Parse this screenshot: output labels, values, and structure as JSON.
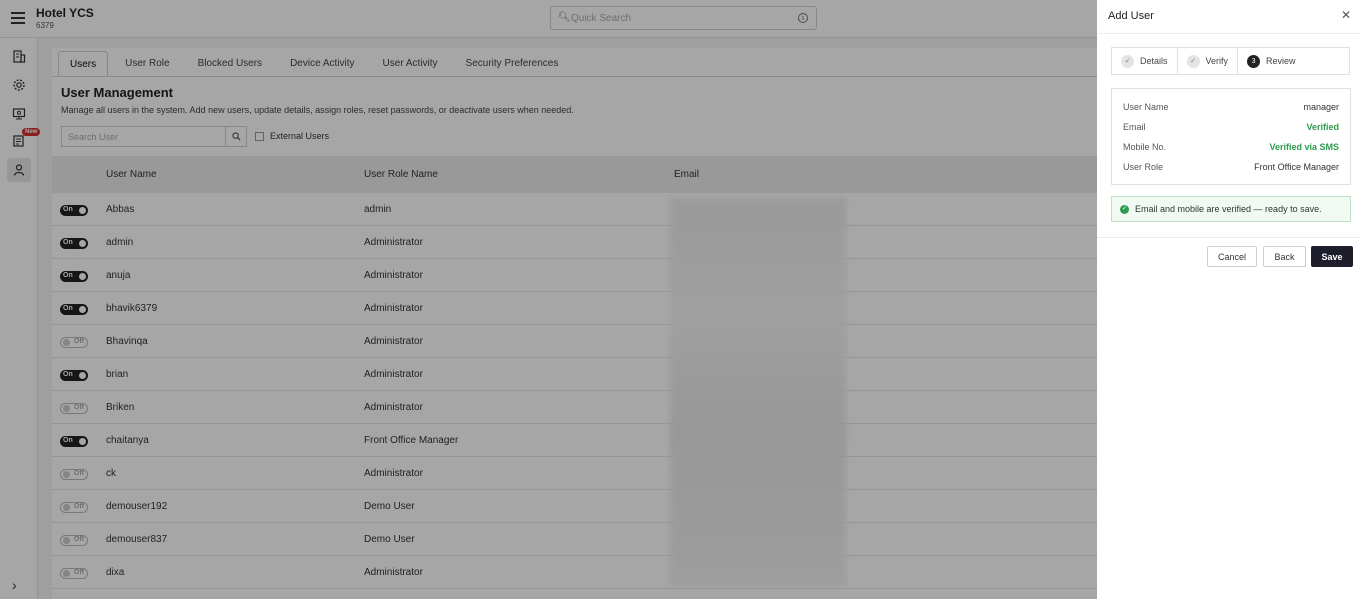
{
  "header": {
    "hotel_name": "Hotel YCS",
    "hotel_code": "6379",
    "quick_search_placeholder": "Quick Search"
  },
  "sidebar": {
    "icons": [
      "building-icon",
      "gear-icon",
      "monitor-icon",
      "report-icon",
      "user-icon"
    ],
    "new_badge": "New"
  },
  "tabs": [
    "Users",
    "User Role",
    "Blocked Users",
    "Device Activity",
    "User Activity",
    "Security Preferences"
  ],
  "page": {
    "title": "User Management",
    "description": "Manage all users in the system. Add new users, update details, assign roles, reset passwords, or deactivate users when needed.",
    "search_placeholder": "Search User",
    "external_users_label": "External Users"
  },
  "table": {
    "headers": [
      "User Name",
      "User Role Name",
      "Email"
    ],
    "toggle_on": "On",
    "toggle_off": "Off",
    "rows": [
      {
        "name": "Abbas",
        "role": "admin",
        "active": true
      },
      {
        "name": "admin",
        "role": "Administrator",
        "active": true
      },
      {
        "name": "anuja",
        "role": "Administrator",
        "active": true
      },
      {
        "name": "bhavik6379",
        "role": "Administrator",
        "active": true
      },
      {
        "name": "Bhavinqa",
        "role": "Administrator",
        "active": false
      },
      {
        "name": "brian",
        "role": "Administrator",
        "active": true
      },
      {
        "name": "Briken",
        "role": "Administrator",
        "active": false
      },
      {
        "name": "chaitanya",
        "role": "Front Office Manager",
        "active": true
      },
      {
        "name": "ck",
        "role": "Administrator",
        "active": false
      },
      {
        "name": "demouser192",
        "role": "Demo User",
        "active": false
      },
      {
        "name": "demouser837",
        "role": "Demo User",
        "active": false
      },
      {
        "name": "dixa",
        "role": "Administrator",
        "active": false
      }
    ]
  },
  "drawer": {
    "title": "Add User",
    "steps": [
      {
        "label": "Details",
        "state": "done",
        "num": "✓"
      },
      {
        "label": "Verify",
        "state": "done",
        "num": "✓"
      },
      {
        "label": "Review",
        "state": "current",
        "num": "3"
      }
    ],
    "review": [
      {
        "key": "User Name",
        "value": "manager",
        "green": false
      },
      {
        "key": "Email",
        "value": "Verified",
        "green": true
      },
      {
        "key": "Mobile No.",
        "value": "Verified via SMS",
        "green": true
      },
      {
        "key": "User Role",
        "value": "Front Office Manager",
        "green": false
      }
    ],
    "alert": "Email and mobile are verified — ready to save.",
    "buttons": {
      "cancel": "Cancel",
      "back": "Back",
      "save": "Save"
    }
  }
}
